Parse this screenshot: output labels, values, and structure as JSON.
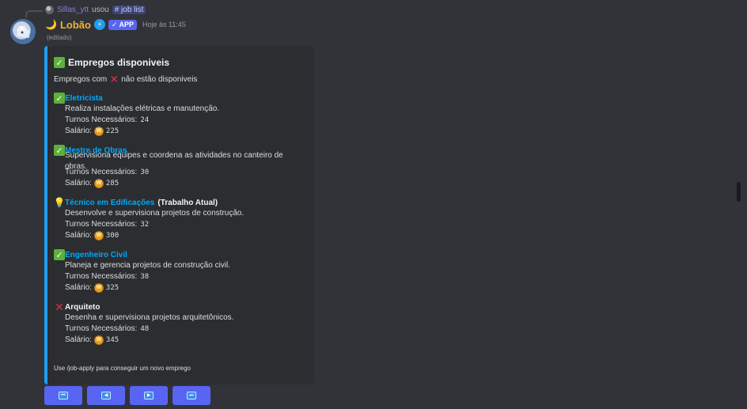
{
  "reply": {
    "user": "Sillas_ytt",
    "verb": "usou",
    "command": "# job list"
  },
  "message": {
    "author": "Lobão",
    "moon_emoji": "🌙",
    "bolt_emoji": "⚡",
    "app_badge": "APP",
    "timestamp": "Hoje às 11:45",
    "edited": "(editado)"
  },
  "embed": {
    "accent_color": "#1e9ef0",
    "title": "Empregos disponiveis",
    "description_prefix": "Empregos com",
    "description_suffix": "não estão disponiveis",
    "jobs": [
      {
        "status": "available",
        "name": "Eletricista",
        "tag": "",
        "description": "Realiza instalações elétricas e manutenção.",
        "turns_label": "Turnos Necessários:",
        "turns": "24",
        "salary_label": "Salário:",
        "salary": "225"
      },
      {
        "status": "available",
        "name": "Mestre de Obras",
        "tag": "",
        "description": "Supervisiona equipes e coordena as atividades no canteiro de obras.",
        "turns_label": "Turnos Necessários:",
        "turns": "30",
        "salary_label": "Salário:",
        "salary": "285"
      },
      {
        "status": "current",
        "name": "Técnico em Edificações",
        "tag": "(Trabalho Atual)",
        "description": "Desenvolve e supervisiona projetos de construção.",
        "turns_label": "Turnos Necessários:",
        "turns": "32",
        "salary_label": "Salário:",
        "salary": "300"
      },
      {
        "status": "available",
        "name": "Engenheiro Civil",
        "tag": "",
        "description": "Planeja e gerencia projetos de construção civil.",
        "turns_label": "Turnos Necessários:",
        "turns": "38",
        "salary_label": "Salário:",
        "salary": "325"
      },
      {
        "status": "unavailable",
        "name": "Arquiteto",
        "tag": "",
        "description": "Desenha e supervisiona projetos arquitetônicos.",
        "turns_label": "Turnos Necessários:",
        "turns": "48",
        "salary_label": "Salário:",
        "salary": "345"
      }
    ],
    "footer": "Use /job-apply para conseguir um novo emprego"
  },
  "buttons": [
    {
      "icon": "first-page-icon",
      "glyph": "⏮"
    },
    {
      "icon": "previous-page-icon",
      "glyph": "◀"
    },
    {
      "icon": "next-page-icon",
      "glyph": "▶"
    },
    {
      "icon": "last-page-icon",
      "glyph": "⏭"
    }
  ]
}
